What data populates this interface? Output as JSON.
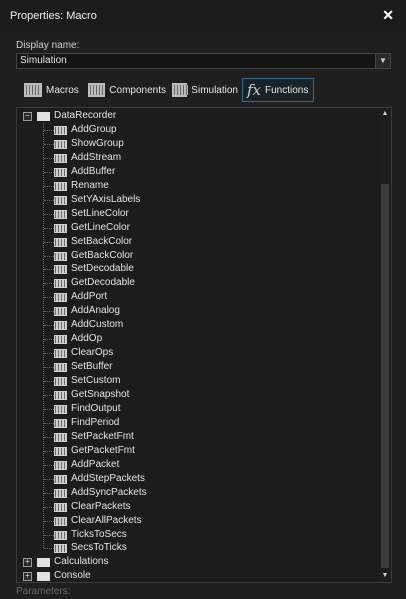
{
  "window": {
    "title": "Properties: Macro"
  },
  "display_name": {
    "label": "Display name:",
    "value": "Simulation"
  },
  "tabs": [
    {
      "label": "Macros",
      "icon": "library-icon",
      "selected": false
    },
    {
      "label": "Components",
      "icon": "library-icon",
      "selected": false
    },
    {
      "label": "Simulation",
      "icon": "library-icon",
      "selected": false
    },
    {
      "label": "Functions",
      "icon": "fx-icon",
      "selected": true
    }
  ],
  "tree": {
    "root": {
      "label": "DataRecorder",
      "expanded": true
    },
    "children": [
      "AddGroup",
      "ShowGroup",
      "AddStream",
      "AddBuffer",
      "Rename",
      "SetYAxisLabels",
      "SetLineColor",
      "GetLineColor",
      "SetBackColor",
      "GetBackColor",
      "SetDecodable",
      "GetDecodable",
      "AddPort",
      "AddAnalog",
      "AddCustom",
      "AddOp",
      "ClearOps",
      "SetBuffer",
      "SetCustom",
      "GetSnapshot",
      "FindOutput",
      "FindPeriod",
      "SetPacketFmt",
      "GetPacketFmt",
      "AddPacket",
      "AddStepPackets",
      "AddSyncPackets",
      "ClearPackets",
      "ClearAllPackets",
      "TicksToSecs",
      "SecsToTicks"
    ],
    "collapsed_roots": [
      {
        "label": "Calculations",
        "expanded": false
      },
      {
        "label": "Console",
        "expanded": false
      }
    ]
  },
  "footer": {
    "label": "Parameters:"
  }
}
